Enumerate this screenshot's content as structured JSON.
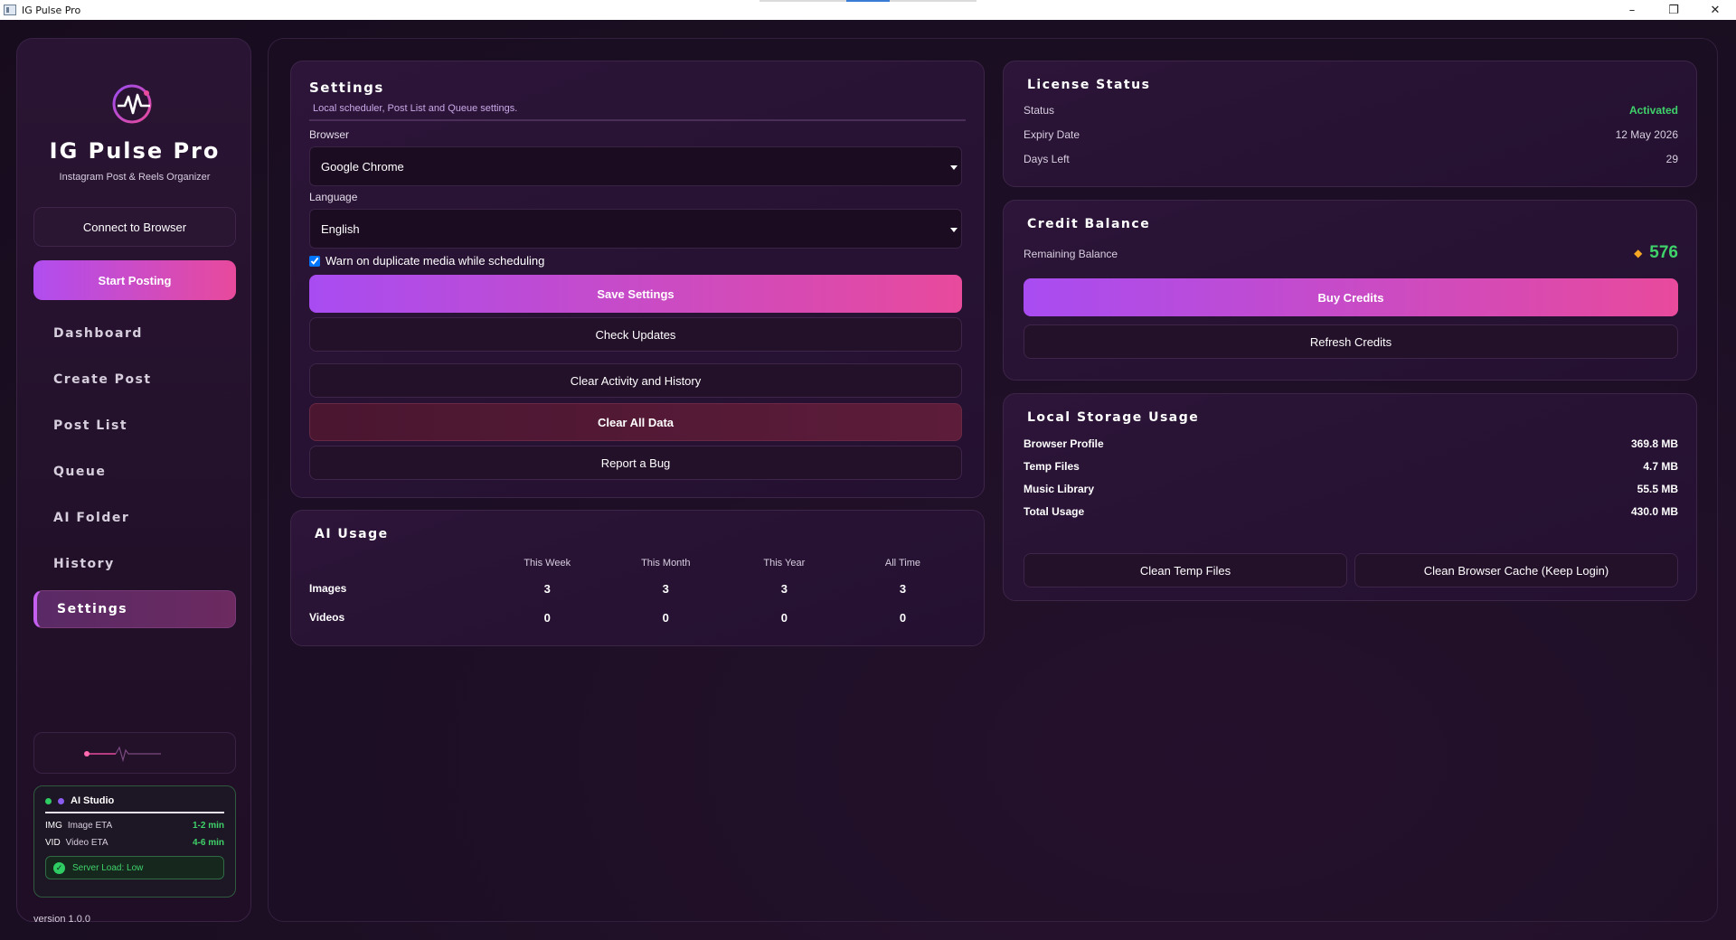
{
  "window": {
    "title": "IG Pulse Pro",
    "controls": [
      "–",
      "❐",
      "✕"
    ]
  },
  "sidebar": {
    "brand": "IG Pulse Pro",
    "tagline": "Instagram Post & Reels Organizer",
    "connect_label": "Connect to Browser",
    "start_label": "Start Posting",
    "nav": [
      {
        "label": "Dashboard"
      },
      {
        "label": "Create Post"
      },
      {
        "label": "Post List"
      },
      {
        "label": "Queue"
      },
      {
        "label": "AI Folder"
      },
      {
        "label": "History"
      },
      {
        "label": "Settings",
        "active": true
      }
    ],
    "ai_studio": {
      "title": "AI Studio",
      "img_tag": "IMG",
      "img_label": "Image ETA",
      "img_value": "1-2 min",
      "vid_tag": "VID",
      "vid_label": "Video ETA",
      "vid_value": "4-6 min",
      "server_load": "Server Load: Low"
    },
    "version": "version 1.0.0"
  },
  "settings": {
    "title": "Settings",
    "subtitle": "Local scheduler, Post List and Queue settings.",
    "browser_label": "Browser",
    "browser_value": "Google Chrome",
    "language_label": "Language",
    "language_value": "English",
    "warn_label": "Warn on duplicate media while scheduling",
    "warn_checked": true,
    "save_label": "Save Settings",
    "check_updates_label": "Check Updates",
    "clear_activity_label": "Clear Activity and History",
    "clear_all_label": "Clear All Data",
    "report_bug_label": "Report a Bug"
  },
  "ai_usage": {
    "title": "AI Usage",
    "columns": [
      "This Week",
      "This Month",
      "This Year",
      "All Time"
    ],
    "rows": [
      {
        "label": "Images",
        "values": [
          "3",
          "3",
          "3",
          "3"
        ]
      },
      {
        "label": "Videos",
        "values": [
          "0",
          "0",
          "0",
          "0"
        ]
      }
    ]
  },
  "license": {
    "title": "License Status",
    "status_label": "Status",
    "status_value": "Activated",
    "expiry_label": "Expiry Date",
    "expiry_value": "12 May 2026",
    "days_label": "Days Left",
    "days_value": "29"
  },
  "credits": {
    "title": "Credit Balance",
    "remaining_label": "Remaining Balance",
    "balance": "576",
    "buy_label": "Buy Credits",
    "refresh_label": "Refresh Credits"
  },
  "storage": {
    "title": "Local Storage Usage",
    "items": [
      {
        "label": "Browser Profile",
        "value": "369.8 MB"
      },
      {
        "label": "Temp Files",
        "value": "4.7 MB"
      },
      {
        "label": "Music Library",
        "value": "55.5 MB"
      },
      {
        "label": "Total Usage",
        "value": "430.0 MB"
      }
    ],
    "clean_temp_label": "Clean Temp Files",
    "clean_cache_label": "Clean Browser Cache (Keep Login)"
  },
  "colors": {
    "accent_start": "#a84cf2",
    "accent_end": "#e84a9c",
    "success": "#3fd26a",
    "danger_bg": "#5c1c3a"
  },
  "icons": {
    "logo": "pulse-logo-icon",
    "credit": "diamond-icon",
    "server_ok": "check-circle-icon"
  }
}
